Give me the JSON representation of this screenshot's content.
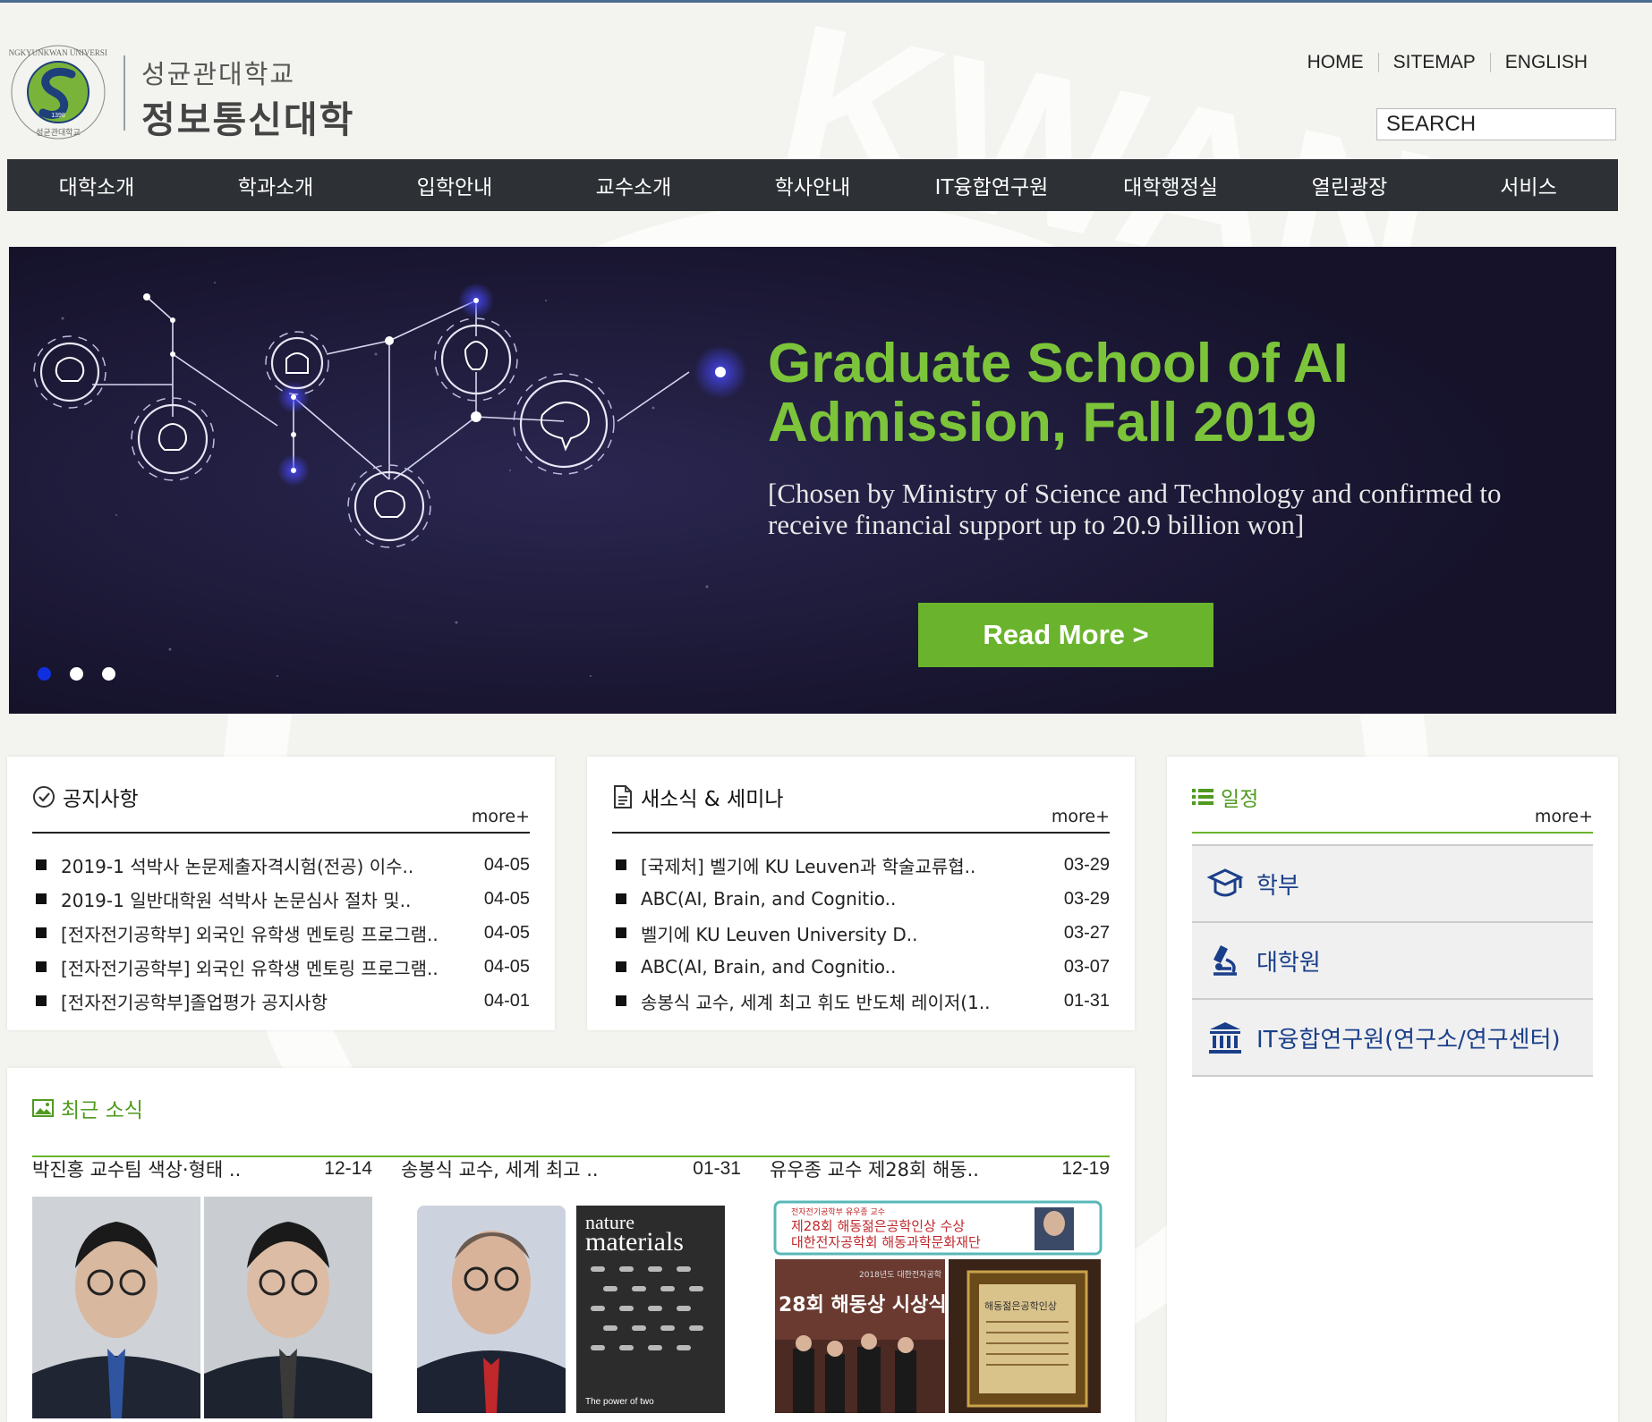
{
  "header": {
    "logo": {
      "line1": "성균관대학교",
      "line2": "정보통신대학",
      "seal_text": "SUNGKYUNKWAN UNIVERSITY",
      "seal_year": "1398",
      "seal_bottom": "성균관대학교"
    },
    "utility_links": [
      "HOME",
      "SITEMAP",
      "ENGLISH"
    ],
    "search_placeholder": "SEARCH",
    "watermark_text": "KWAN"
  },
  "nav": [
    "대학소개",
    "학과소개",
    "입학안내",
    "교수소개",
    "학사안내",
    "IT융합연구원",
    "대학행정실",
    "열린광장",
    "서비스"
  ],
  "banner": {
    "title_line1": "Graduate School of AI",
    "title_line2": "Admission, Fall 2019",
    "subtitle": "[Chosen by Ministry of Science and Technology and confirmed to receive financial support up to 20.9 billion won]",
    "button_label": "Read More >",
    "slides_total": 3,
    "active_slide": 1
  },
  "notice": {
    "title": "공지사항",
    "more": "more+",
    "items": [
      {
        "title": "2019-1 석박사 논문제출자격시험(전공) 이수..",
        "date": "04-05"
      },
      {
        "title": "2019-1 일반대학원 석박사 논문심사 절차 및..",
        "date": "04-05"
      },
      {
        "title": "[전자전기공학부] 외국인 유학생 멘토링 프로그램..",
        "date": "04-05"
      },
      {
        "title": "[전자전기공학부] 외국인 유학생 멘토링 프로그램..",
        "date": "04-05"
      },
      {
        "title": "[전자전기공학부]졸업평가 공지사항",
        "date": "04-01"
      }
    ]
  },
  "news": {
    "title": "새소식 & 세미나",
    "more": "more+",
    "items": [
      {
        "title": "[국제처] 벨기에 KU Leuven과 학술교류협..",
        "date": "03-29"
      },
      {
        "title": "ABC(AI, Brain, and Cognitio..",
        "date": "03-29"
      },
      {
        "title": "벨기에 KU Leuven University D..",
        "date": "03-27"
      },
      {
        "title": "ABC(AI, Brain, and Cognitio..",
        "date": "03-07"
      },
      {
        "title": "송봉식 교수, 세계 최고 휘도 반도체 레이저(1..",
        "date": "01-31"
      }
    ]
  },
  "schedule": {
    "title": "일정",
    "more": "more+",
    "items": [
      "학부",
      "대학원",
      "IT융합연구원(연구소/연구센터)"
    ]
  },
  "recent": {
    "title": "최근 소식",
    "items": [
      {
        "title": "박진홍 교수팀 색상·형태 ..",
        "date": "12-14"
      },
      {
        "title": "송봉식 교수, 세계 최고 ..",
        "date": "01-31"
      },
      {
        "title": "유우종 교수 제28회 해동..",
        "date": "12-19"
      }
    ],
    "journal_name_top": "nature",
    "journal_name_bottom": "materials",
    "journal_footer": "The power of two",
    "award_banner_small": "전자전기공학부 유우종 교수",
    "award_banner_line1": "제28회 해동젊은공학인상 수상",
    "award_banner_line2": "대한전자공학회 해동과학문화재단",
    "award_photo_caption": "28회 해동상 시상식",
    "award_photo_year": "2018년도 대한전자공학",
    "plaque_text": "해동젊은공학인상"
  },
  "colors": {
    "accent_green": "#6ab42d",
    "nav_bg": "#2d3135",
    "banner_bg": "#17142a",
    "schedule_link": "#1a3f8a",
    "dot_active": "#1030e0"
  }
}
